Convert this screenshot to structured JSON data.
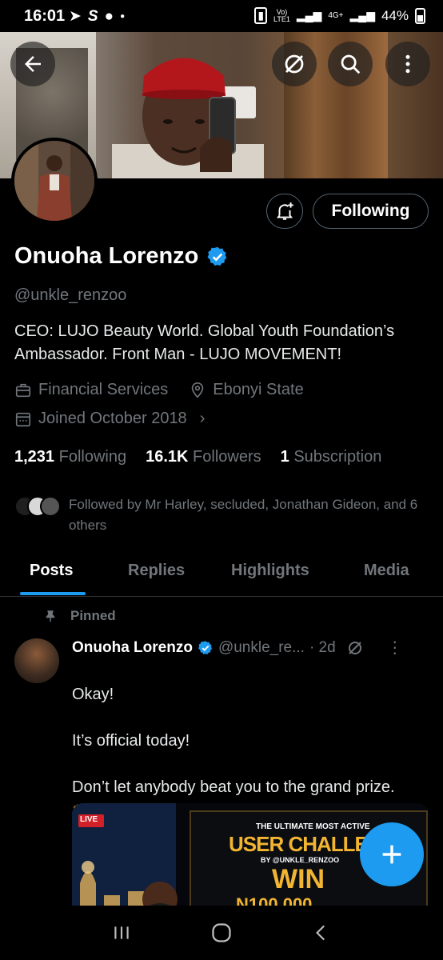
{
  "status_bar": {
    "time": "16:01",
    "network_label": "Vo)\nLTE1",
    "network_type": "4G+",
    "battery": "44%"
  },
  "profile": {
    "name": "Onuoha Lorenzo",
    "handle": "@unkle_renzoo",
    "bio": "CEO: LUJO Beauty World. Global Youth Foundation’s Ambassador. Front Man - LUJO MOVEMENT!",
    "category": "Financial Services",
    "location": "Ebonyi State",
    "joined": "Joined October 2018",
    "following_count": "1,231",
    "following_label": "Following",
    "followers_count": "16.1K",
    "followers_label": "Followers",
    "subscription_count": "1",
    "subscription_label": "Subscription",
    "followed_by": "Followed by Mr Harley, secluded, Jonathan Gideon, and 6 others",
    "follow_button_label": "Following"
  },
  "tabs": [
    "Posts",
    "Replies",
    "Highlights",
    "Media"
  ],
  "active_tab": "Posts",
  "pinned_post": {
    "pinned_label": "Pinned",
    "author_name": "Onuoha Lorenzo",
    "author_handle": "@unkle_re...",
    "time": "· 2d",
    "text": "Okay!\n\nIt’s official today!\n\nDon’t let anybody beat you to the grand prize.",
    "emoji": "👊",
    "image": {
      "live_badge": "LIVE",
      "line1": "THE ULTIMATE MOST ACTIVE",
      "line2": "USER CHALLENGE",
      "line3": "BY @UNKLE_RENZOO",
      "line4": "WIN",
      "line5": "N100,000"
    }
  },
  "colors": {
    "accent": "#1d9bf0",
    "secondary_text": "#71767b",
    "background": "#000000"
  },
  "icons": {
    "back": "arrow-left-icon",
    "no_grok": "slashed-circle-icon",
    "search": "search-icon",
    "more": "more-vertical-icon",
    "notifications": "bell-plus-icon",
    "category": "briefcase-icon",
    "location": "location-pin-icon",
    "joined": "calendar-icon",
    "pinned": "pin-icon",
    "compose": "plus-icon"
  }
}
